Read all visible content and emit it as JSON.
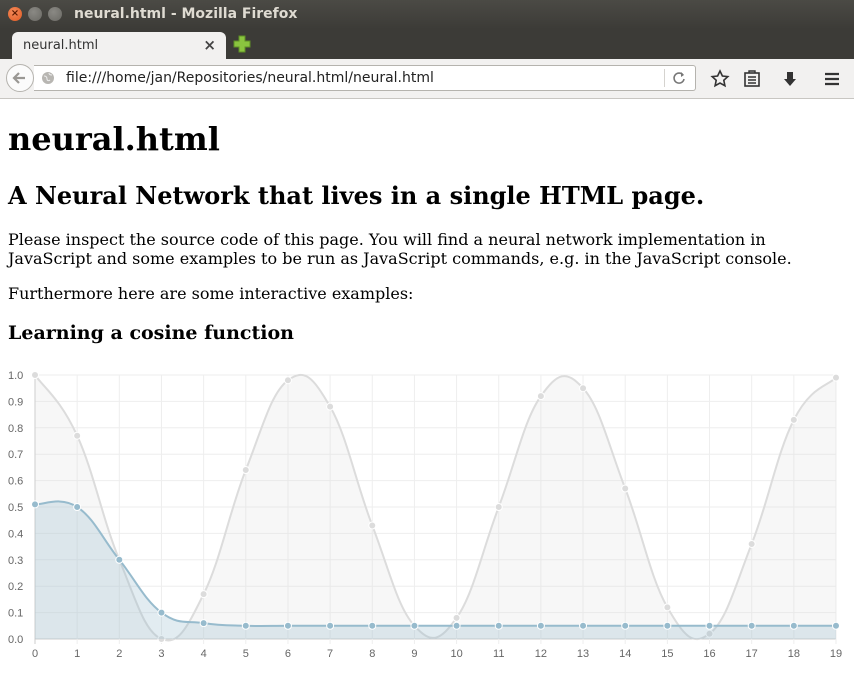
{
  "window": {
    "title": "neural.html - Mozilla Firefox"
  },
  "tabs": [
    {
      "label": "neural.html"
    }
  ],
  "navbar": {
    "url": "file:///home/jan/Repositories/neural.html/neural.html"
  },
  "page": {
    "heading": "neural.html",
    "subheading": "A Neural Network that lives in a single HTML page.",
    "intro": "Please inspect the source code of this page. You will find a neural network implementation in JavaScript and some examples to be run as JavaScript commands, e.g. in the JavaScript console.",
    "examples_intro": "Furthermore here are some interactive examples:",
    "section_title": "Learning a cosine function"
  },
  "colors": {
    "target": "#dcdcdc",
    "prediction": "#97bbcd"
  },
  "chart_data": {
    "type": "line",
    "categories": [
      0,
      1,
      2,
      3,
      4,
      5,
      6,
      7,
      8,
      9,
      10,
      11,
      12,
      13,
      14,
      15,
      16,
      17,
      18,
      19
    ],
    "ylim": [
      0,
      1.0
    ],
    "yticks": [
      "0.0",
      "0.1",
      "0.2",
      "0.3",
      "0.4",
      "0.5",
      "0.6",
      "0.7",
      "0.8",
      "0.9",
      "1.0"
    ],
    "grid": true,
    "series": [
      {
        "color": "#dcdcdc",
        "values": [
          1.0,
          0.77,
          0.3,
          0.0,
          0.17,
          0.64,
          0.98,
          0.88,
          0.43,
          0.05,
          0.08,
          0.5,
          0.92,
          0.95,
          0.57,
          0.12,
          0.02,
          0.36,
          0.83,
          0.99
        ]
      },
      {
        "color": "#97bbcd",
        "values": [
          0.51,
          0.5,
          0.3,
          0.1,
          0.06,
          0.05,
          0.05,
          0.05,
          0.05,
          0.05,
          0.05,
          0.05,
          0.05,
          0.05,
          0.05,
          0.05,
          0.05,
          0.05,
          0.05,
          0.05
        ]
      }
    ]
  }
}
